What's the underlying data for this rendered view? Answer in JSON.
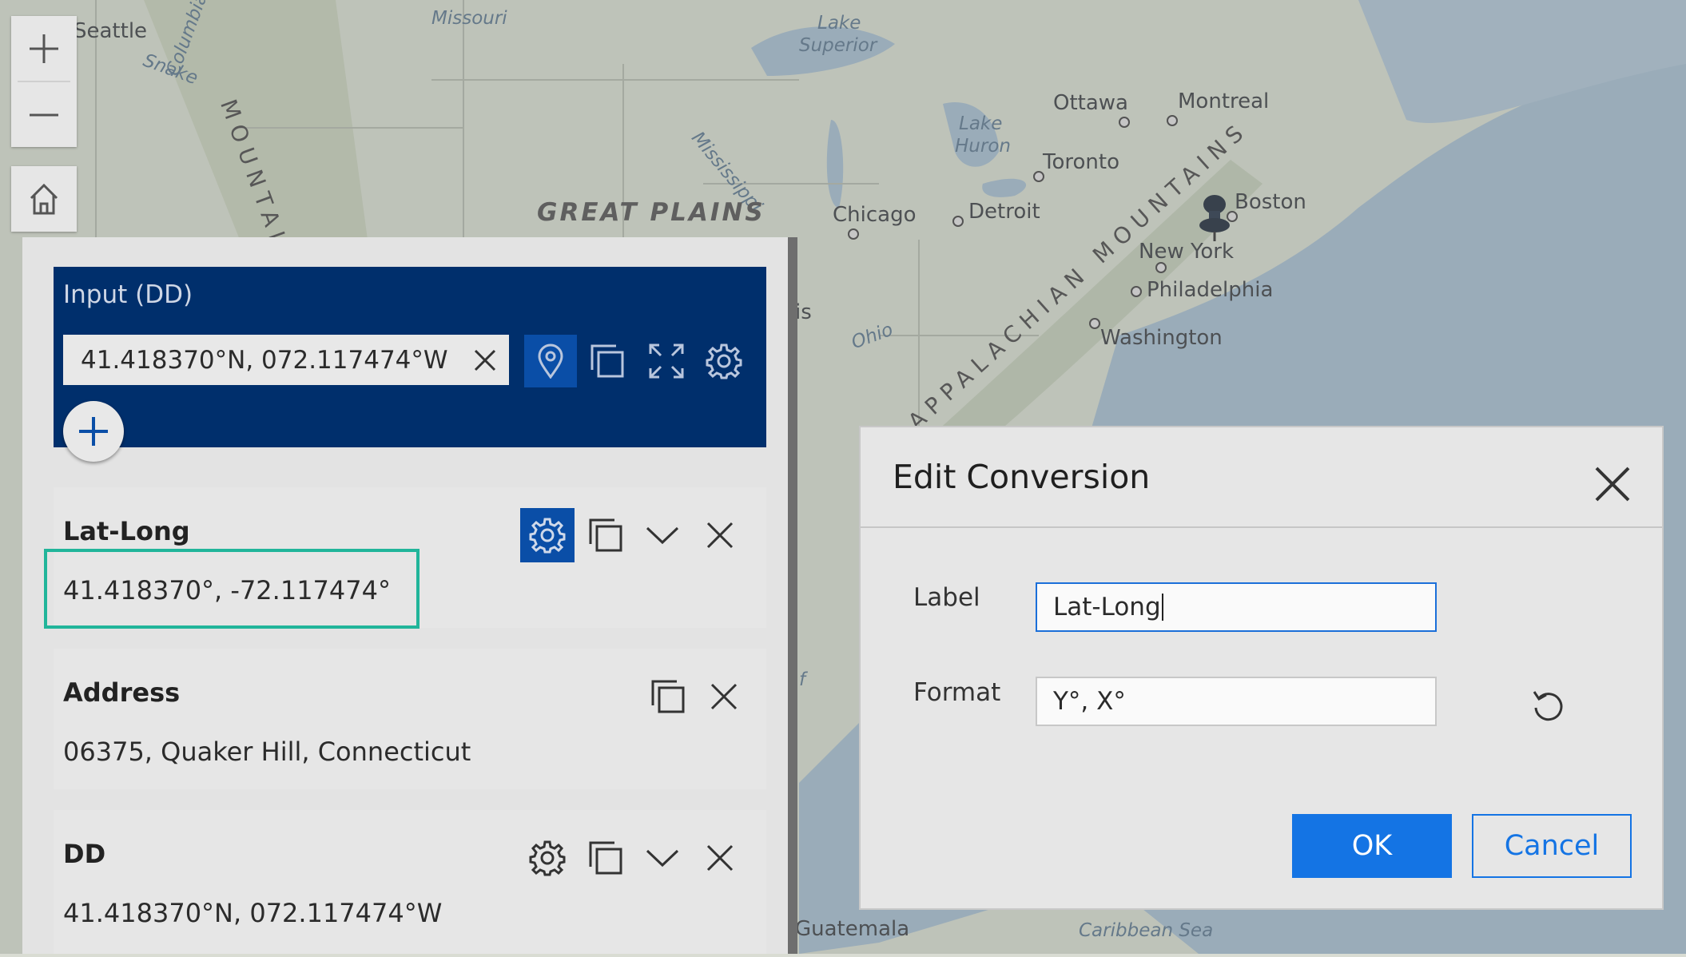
{
  "map": {
    "labels": {
      "seattle": "Seattle",
      "snake": "Snake",
      "columbia": "Columbia",
      "missouri": "Missouri",
      "lake_superior_1": "Lake",
      "lake_superior_2": "Superior",
      "lake_huron_1": "Lake",
      "lake_huron_2": "Huron",
      "mississippi": "Mississippi",
      "great_plains": "GREAT PLAINS",
      "mountains": "MOUNTAI",
      "ottawa": "Ottawa",
      "montreal": "Montreal",
      "toronto": "Toronto",
      "chicago": "Chicago",
      "detroit": "Detroit",
      "boston": "Boston",
      "new_york": "New York",
      "philadelphia": "Philadelphia",
      "washington": "Washington",
      "ohio": "Ohio",
      "appalachian": "APPALACHIAN MOUNTAINS",
      "guatemala": "Guatemala",
      "caribbean": "Caribbean Sea",
      "partial_is": "is",
      "partial_f": "f"
    }
  },
  "zoom": {
    "in_label": "+",
    "out_label": "—"
  },
  "input_panel": {
    "title": "Input (DD)",
    "value": "41.418370°N, 072.117474°W"
  },
  "conversions": [
    {
      "title": "Lat-Long",
      "value": "41.418370°, -72.117474°"
    },
    {
      "title": "Address",
      "value": "06375, Quaker Hill, Connecticut"
    },
    {
      "title": "DD",
      "value": "41.418370°N, 072.117474°W"
    }
  ],
  "dialog": {
    "title": "Edit Conversion",
    "label_caption": "Label",
    "label_value": "Lat-Long",
    "format_caption": "Format",
    "format_value": "Y°, X°",
    "ok_label": "OK",
    "cancel_label": "Cancel"
  },
  "colors": {
    "input_panel_bg": "#002f6c",
    "accent": "#1474e4",
    "highlight": "#21b59a"
  }
}
